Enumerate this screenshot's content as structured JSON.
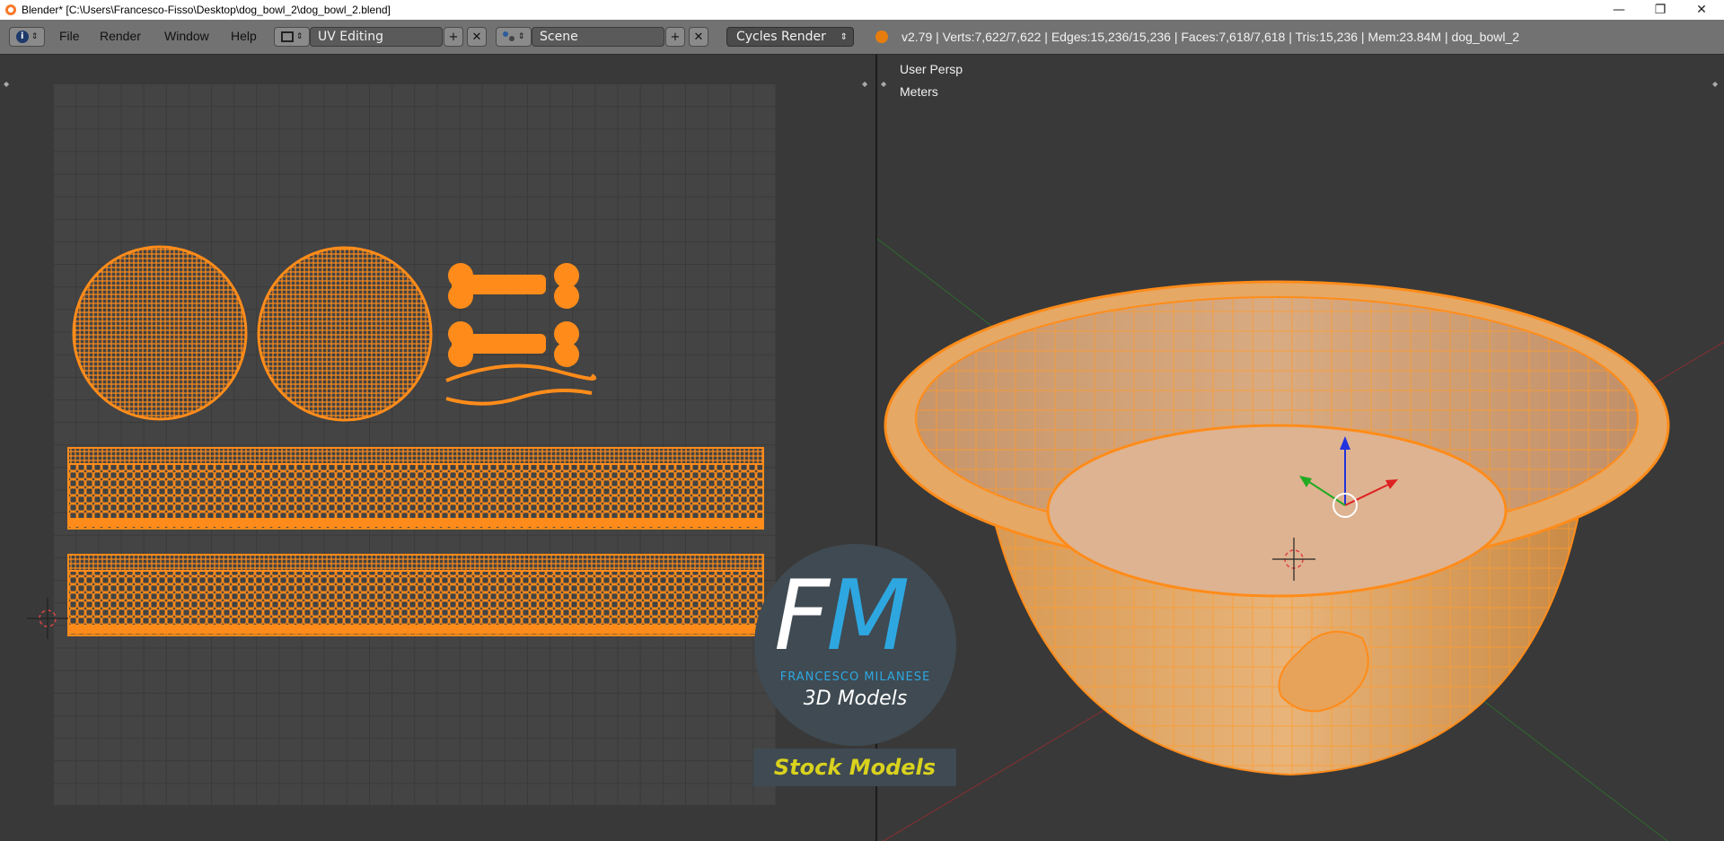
{
  "window": {
    "title": "Blender* [C:\\Users\\Francesco-Fisso\\Desktop\\dog_bowl_2\\dog_bowl_2.blend]",
    "minimize": "—",
    "restore": "❐",
    "close": "✕"
  },
  "header": {
    "info_icon": "i",
    "menus": [
      "File",
      "Render",
      "Window",
      "Help"
    ],
    "screen_layout": "UV Editing",
    "scene": "Scene",
    "render_engine": "Cycles Render",
    "stats": "v2.79 | Verts:7,622/7,622 | Edges:15,236/15,236 | Faces:7,618/7,618 | Tris:15,236 | Mem:23.84M | dog_bowl_2",
    "add_symbol": "+",
    "remove_symbol": "✕"
  },
  "viewport": {
    "view_name": "User Persp",
    "units": "Meters"
  },
  "logo": {
    "letter_f": "F",
    "letter_m": "M",
    "name": "FRANCESCO MILANESE",
    "subtitle": "3D Models",
    "banner": "Stock Models"
  },
  "colors": {
    "accent_orange": "#ff8c1a",
    "logo_blue": "#2ea7e0",
    "logo_yellow": "#d9d21e"
  }
}
